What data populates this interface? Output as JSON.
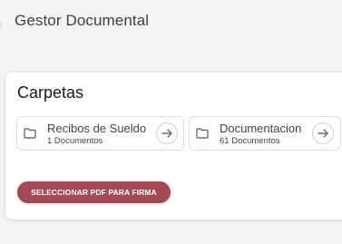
{
  "app": {
    "title": "Gestor Documental"
  },
  "section": {
    "title": "Carpetas",
    "folders": [
      {
        "name": "Recibos de Sueldo",
        "count_label": "1 Documentos",
        "icon": "folder-icon",
        "action_icon": "arrow-right-icon"
      },
      {
        "name": "Documentacion",
        "count_label": "61 Documentos",
        "icon": "folder-icon",
        "action_icon": "arrow-right-icon"
      }
    ]
  },
  "actions": {
    "select_pdf_label": "SELECCIONAR PDF PARA FIRMA"
  },
  "colors": {
    "background": "#f4f4f4",
    "card": "#ffffff",
    "primary_button": "#a34a55",
    "primary_text": "#ffffff",
    "text": "#444444"
  }
}
